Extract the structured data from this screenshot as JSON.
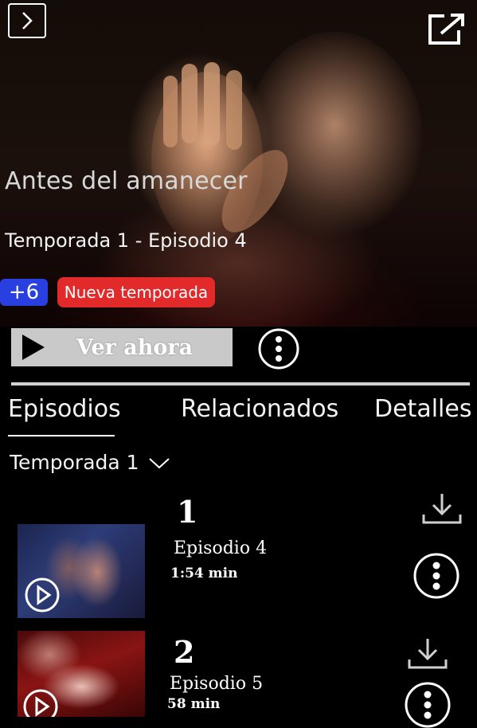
{
  "header": {
    "back_icon": "chevron-right-icon",
    "share_icon": "open-external-icon"
  },
  "show": {
    "title": "Antes del amanecer",
    "season_episode": "Temporada 1 - Episodio 4",
    "extra_count": "+6",
    "new_season_badge": "Nueva temporada"
  },
  "actions": {
    "watch_label": "Ver ahora"
  },
  "tabs": [
    {
      "label": "Episodios",
      "selected": true
    },
    {
      "label": "Relacionados",
      "selected": false
    },
    {
      "label": "Detalles",
      "selected": false
    }
  ],
  "season_selector": {
    "label": "Temporada 1"
  },
  "episodes": [
    {
      "number": "1",
      "title": "Episodio 4",
      "duration": "1:54 min"
    },
    {
      "number": "2",
      "title": "Episodio 5",
      "duration": "58 min"
    }
  ],
  "colors": {
    "badge_count": "#2a3fe0",
    "badge_new": "#e22a2a",
    "watch_button": "#c9c9c9"
  }
}
